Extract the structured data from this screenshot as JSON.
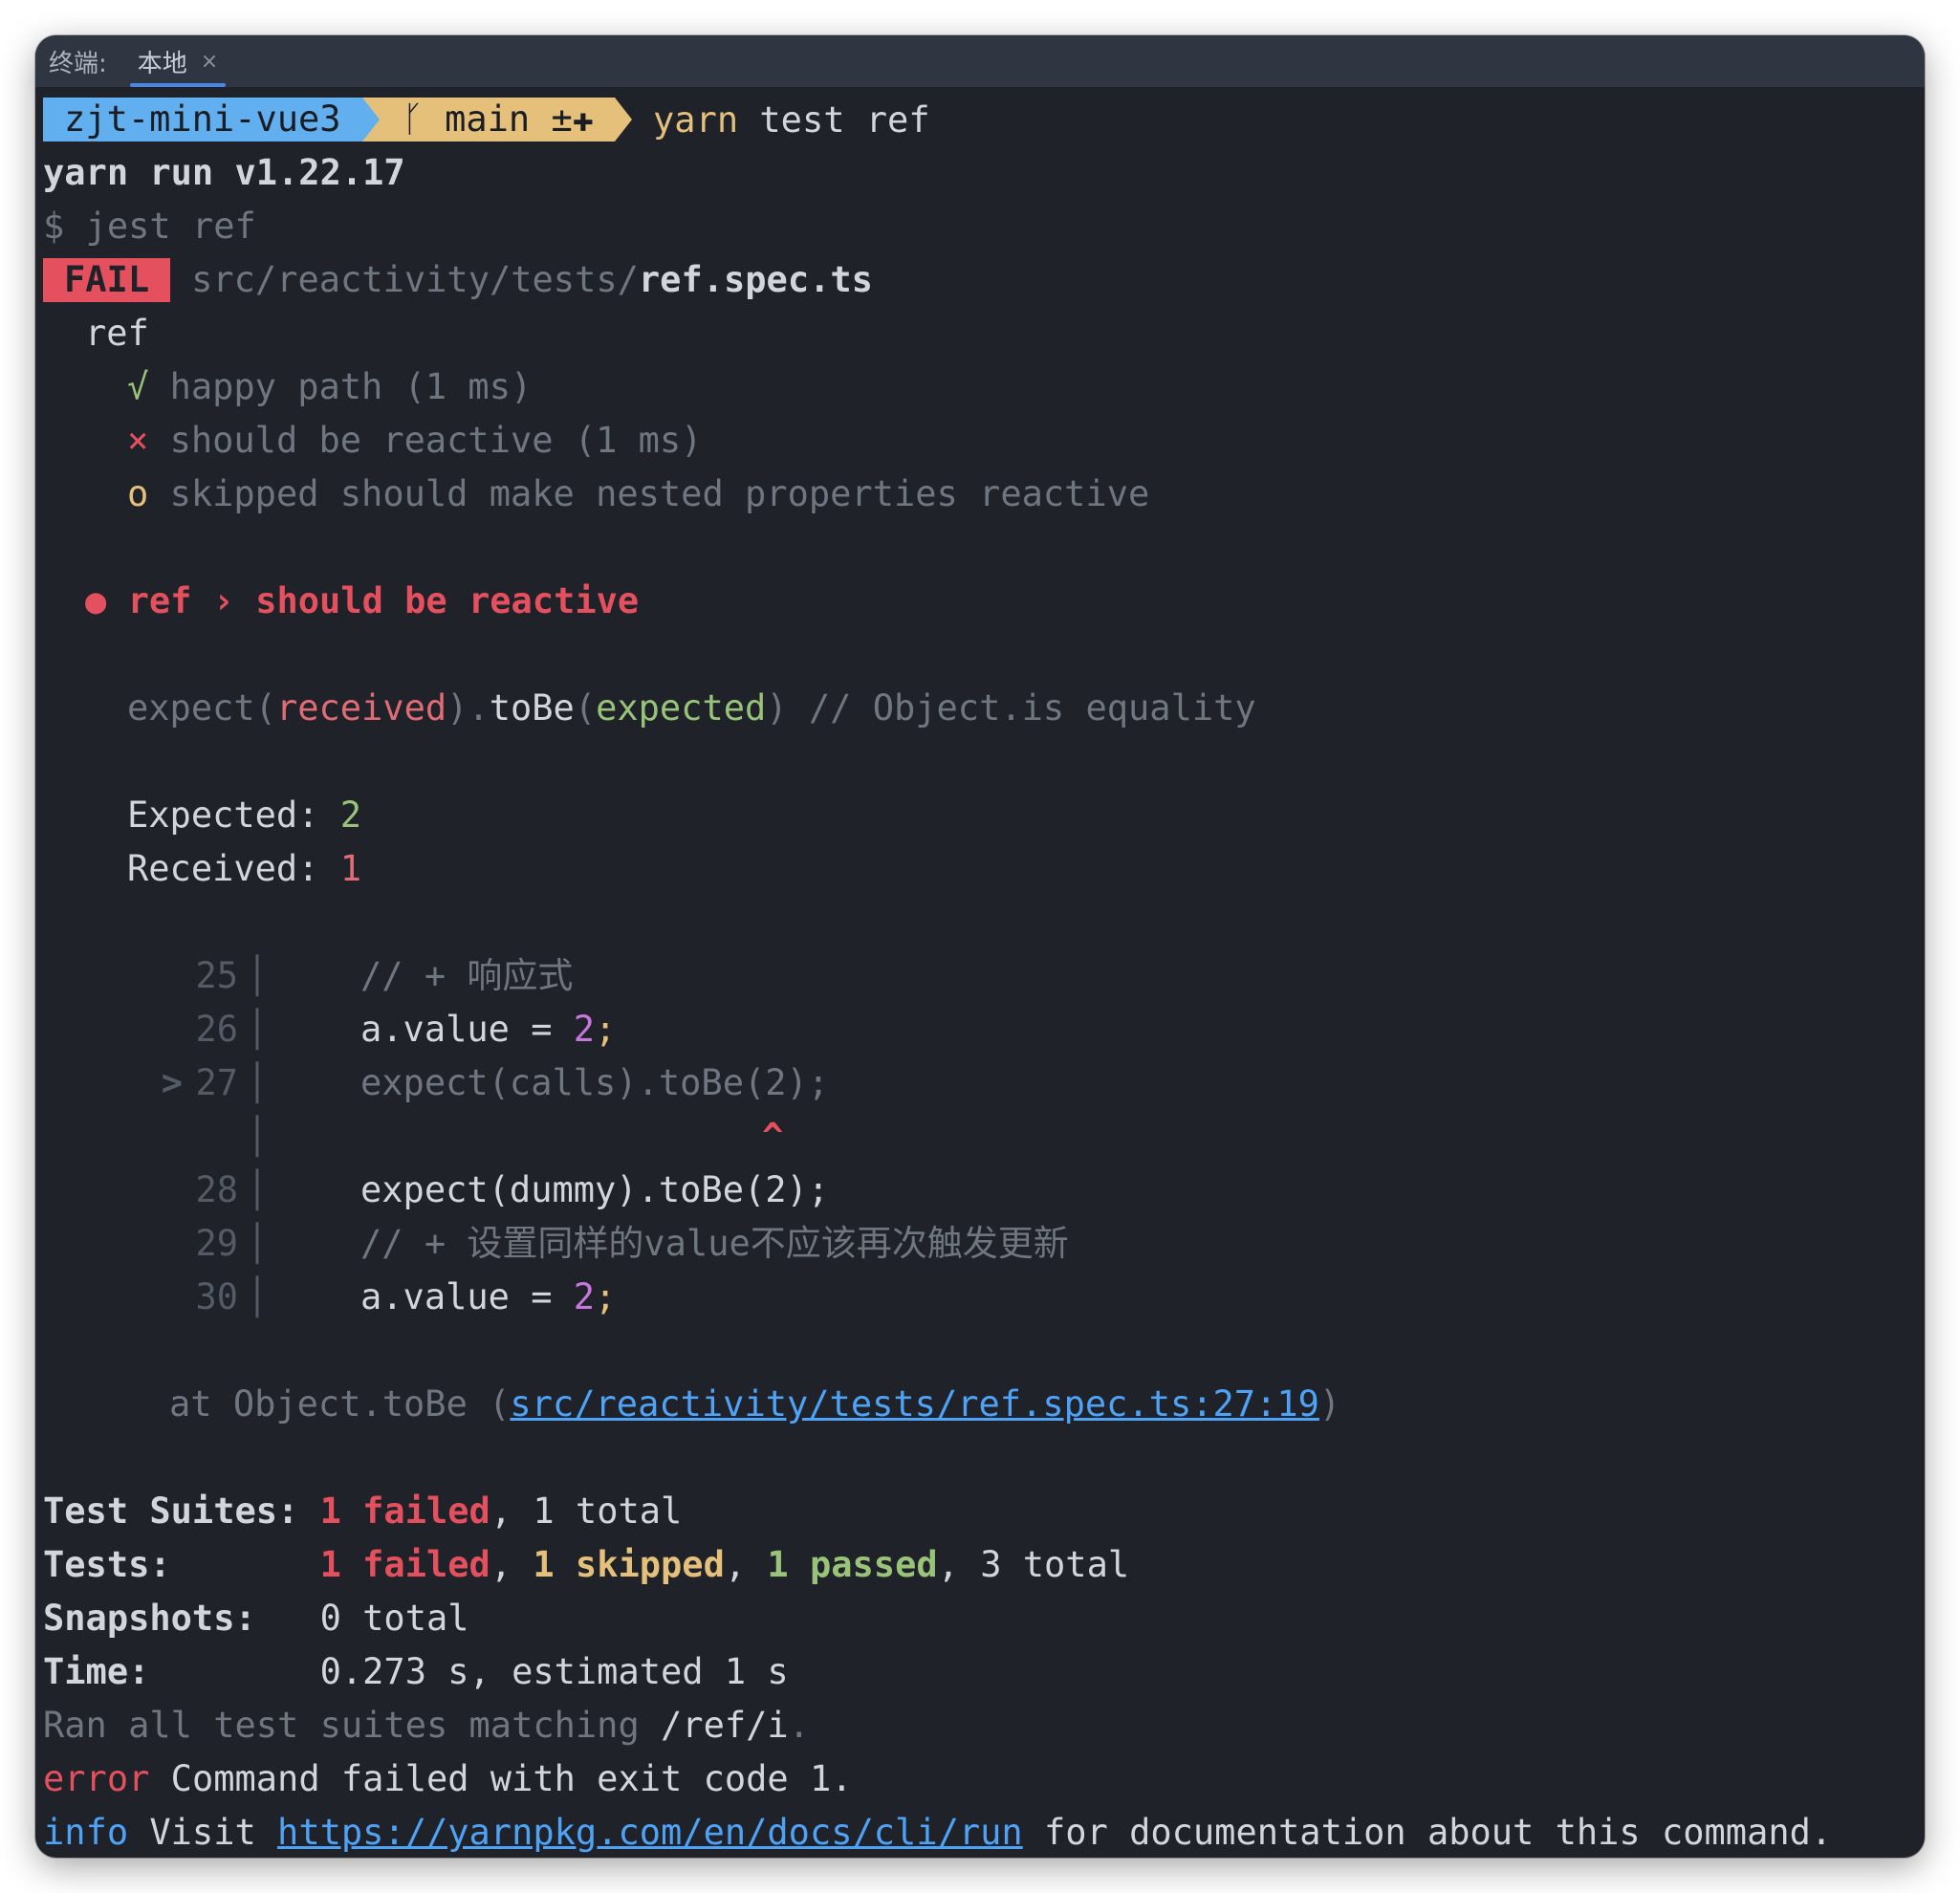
{
  "tabbar": {
    "prefix": "终端:",
    "tab_label": "本地",
    "close": "×"
  },
  "prompt": {
    "dir": "zjt-mini-vue3",
    "branch_icon": "ᚴ",
    "branch": "main ±✚",
    "cmd1": "yarn",
    "cmd2": " test ref"
  },
  "lines": {
    "yarn_run": "yarn run v1.22.17",
    "jest_cmd": "$ jest ref",
    "fail_badge": "FAIL",
    "fail_path_dim": "src/reactivity/tests/",
    "fail_path_file": "ref.spec.ts",
    "describe": "ref",
    "t1_icon": "√",
    "t1_text": "happy path (1 ms)",
    "t2_icon": "×",
    "t2_text": "should be reactive (1 ms)",
    "t3_icon": "o",
    "t3_text": "skipped should make nested properties reactive",
    "err_bullet": "●",
    "err_title": "ref › should be reactive",
    "exp_a": "expect(",
    "exp_received": "received",
    "exp_b": ").",
    "exp_tobe": "toBe",
    "exp_c": "(",
    "exp_expected": "expected",
    "exp_d": ") // Object.is equality",
    "expected_label": "Expected: ",
    "expected_val": "2",
    "received_label": "Received: ",
    "received_val": "1",
    "at_prefix": "at Object.toBe (",
    "at_link": "src/reactivity/tests/ref.spec.ts:27:19",
    "at_suffix": ")"
  },
  "code": [
    {
      "marker": "",
      "num": "25",
      "text": "// + 响应式"
    },
    {
      "marker": "",
      "num": "26",
      "a": "a",
      "b": ".value = ",
      "val": "2",
      "end": ";"
    },
    {
      "marker": ">",
      "num": "27",
      "text": "expect(calls).toBe(2);",
      "caret": "^"
    },
    {
      "marker": "",
      "num": "28",
      "text": "expect(dummy).toBe(2);"
    },
    {
      "marker": "",
      "num": "29",
      "text": "// + 设置同样的value不应该再次触发更新"
    },
    {
      "marker": "",
      "num": "30",
      "a": "a",
      "b": ".value = ",
      "val": "2",
      "end": ";"
    }
  ],
  "summary": {
    "suites_label": "Test Suites: ",
    "suites_failed": "1 failed",
    "suites_rest": ", 1 total",
    "tests_label": "Tests:       ",
    "tests_failed": "1 failed",
    "tests_sep1": ", ",
    "tests_skipped": "1 skipped",
    "tests_sep2": ", ",
    "tests_passed": "1 passed",
    "tests_rest": ", 3 total",
    "snap_label": "Snapshots:   ",
    "snap_val": "0 total",
    "time_label": "Time:        ",
    "time_val": "0.273 s, estimated 1 s",
    "ran_a": "Ran all test suites matching ",
    "ran_b": "/ref/i",
    "ran_c": ".",
    "error_word": "error",
    "error_text": " Command failed with exit code 1.",
    "info_word": "info",
    "info_a": " Visit ",
    "info_link": "https://yarnpkg.com/en/docs/cli/run",
    "info_b": " for documentation about this command."
  },
  "colors": {
    "background": "#1f2229",
    "tabbar": "#2f3541",
    "prompt_dir": "#61afef",
    "prompt_branch": "#e5c07b",
    "fail": "#e5505e",
    "green": "#98c379",
    "purple": "#c678dd",
    "link": "#4fa3f7"
  }
}
